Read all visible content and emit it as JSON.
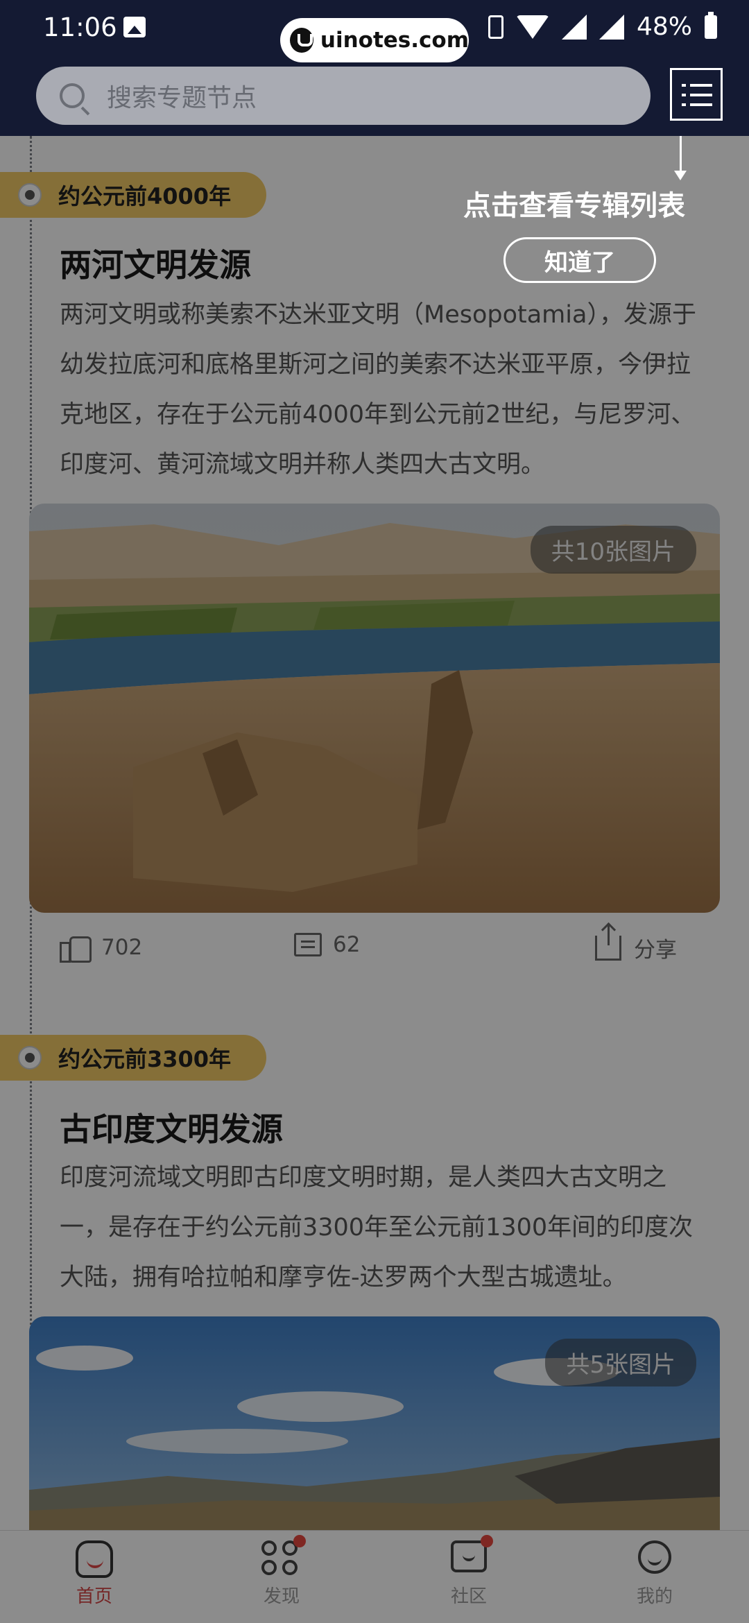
{
  "status_bar": {
    "time": "11:06",
    "battery": "48%"
  },
  "watermark": {
    "text": "uinotes.com"
  },
  "search": {
    "placeholder": "搜索专题节点"
  },
  "hint": {
    "text": "点击查看专辑列表",
    "button_label": "知道了"
  },
  "cards": [
    {
      "era": "约公元前4000年",
      "title": "两河文明发源",
      "description": "两河文明或称美索不达米亚文明（Mesopotamia），发源于幼发拉底河和底格里斯河之间的美索不达米亚平原，今伊拉克地区，存在于公元前4000年到公元前2世纪，与尼罗河、印度河、黄河流域文明并称人类四大古文明。",
      "image_count": "共10张图片",
      "likes": "702",
      "comments": "62",
      "share_label": "分享"
    },
    {
      "era": "约公元前3300年",
      "title": "古印度文明发源",
      "description": "印度河流域文明即古印度文明时期，是人类四大古文明之一，是存在于约公元前3300年至公元前1300年间的印度次大陆，拥有哈拉帕和摩亨佐-达罗两个大型古城遗址。",
      "image_count": "共5张图片"
    }
  ],
  "bottom_nav": [
    {
      "label": "首页",
      "icon": "home-icon",
      "active": true
    },
    {
      "label": "发现",
      "icon": "discover-icon",
      "badge": true
    },
    {
      "label": "社区",
      "icon": "community-icon",
      "badge": true
    },
    {
      "label": "我的",
      "icon": "profile-icon"
    }
  ],
  "colors": {
    "accent": "#f3ca66",
    "header_bg": "#141a33",
    "active_nav": "#d64545",
    "badge": "#e8473f"
  }
}
